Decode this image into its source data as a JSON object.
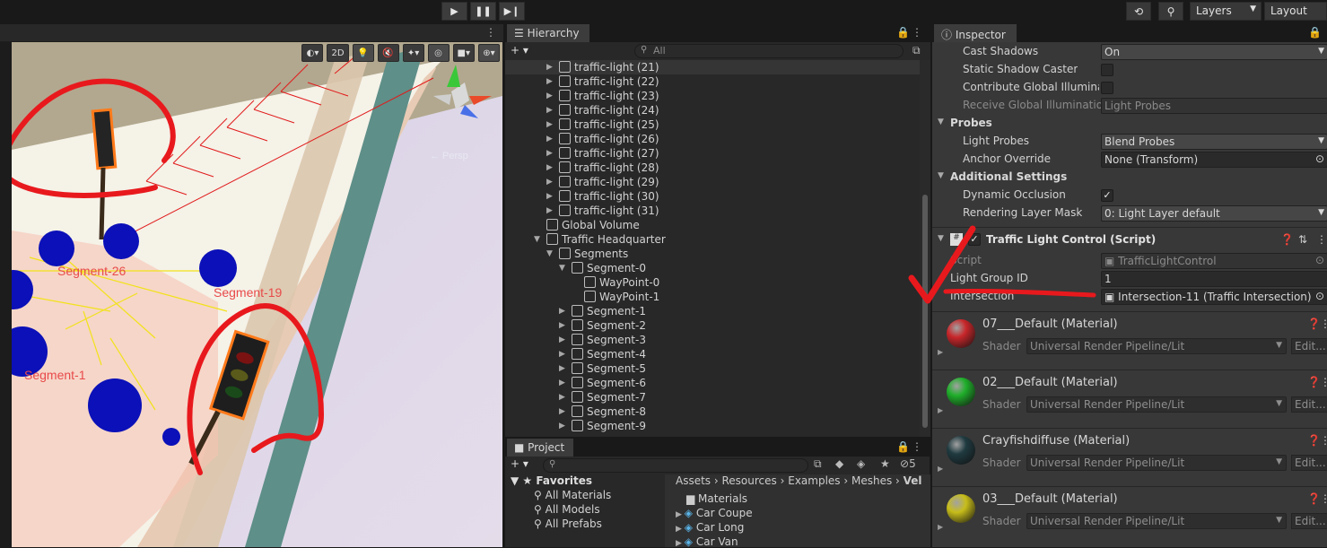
{
  "toolbar": {
    "play_icon": "play-icon",
    "pause_icon": "pause-icon",
    "step_icon": "step-icon",
    "history_icon": "history-icon",
    "search_icon": "search-icon",
    "layers_label": "Layers",
    "layout_label": "Layout"
  },
  "scene": {
    "mode_2d": "2D",
    "persp_label": "← Persp",
    "segment_labels": [
      "Segment-26",
      "Segment-19",
      "Segment-1"
    ]
  },
  "hierarchy": {
    "tab_label": "Hierarchy",
    "add_label": "+ ▾",
    "search_placeholder": "All",
    "rows": [
      {
        "label": "traffic-light (21)",
        "depth": 2,
        "arrow": "▶"
      },
      {
        "label": "traffic-light (22)",
        "depth": 2,
        "arrow": "▶"
      },
      {
        "label": "traffic-light (23)",
        "depth": 2,
        "arrow": "▶"
      },
      {
        "label": "traffic-light (24)",
        "depth": 2,
        "arrow": "▶"
      },
      {
        "label": "traffic-light (25)",
        "depth": 2,
        "arrow": "▶"
      },
      {
        "label": "traffic-light (26)",
        "depth": 2,
        "arrow": "▶"
      },
      {
        "label": "traffic-light (27)",
        "depth": 2,
        "arrow": "▶"
      },
      {
        "label": "traffic-light (28)",
        "depth": 2,
        "arrow": "▶"
      },
      {
        "label": "traffic-light (29)",
        "depth": 2,
        "arrow": "▶"
      },
      {
        "label": "traffic-light (30)",
        "depth": 2,
        "arrow": "▶"
      },
      {
        "label": "traffic-light (31)",
        "depth": 2,
        "arrow": "▶"
      },
      {
        "label": "Global Volume",
        "depth": 1,
        "arrow": ""
      },
      {
        "label": "Traffic Headquarter",
        "depth": 1,
        "arrow": "▼"
      },
      {
        "label": "Segments",
        "depth": 2,
        "arrow": "▼"
      },
      {
        "label": "Segment-0",
        "depth": 3,
        "arrow": "▼"
      },
      {
        "label": "WayPoint-0",
        "depth": 4,
        "arrow": ""
      },
      {
        "label": "WayPoint-1",
        "depth": 4,
        "arrow": ""
      },
      {
        "label": "Segment-1",
        "depth": 3,
        "arrow": "▶"
      },
      {
        "label": "Segment-2",
        "depth": 3,
        "arrow": "▶"
      },
      {
        "label": "Segment-3",
        "depth": 3,
        "arrow": "▶"
      },
      {
        "label": "Segment-4",
        "depth": 3,
        "arrow": "▶"
      },
      {
        "label": "Segment-5",
        "depth": 3,
        "arrow": "▶"
      },
      {
        "label": "Segment-6",
        "depth": 3,
        "arrow": "▶"
      },
      {
        "label": "Segment-7",
        "depth": 3,
        "arrow": "▶"
      },
      {
        "label": "Segment-8",
        "depth": 3,
        "arrow": "▶"
      },
      {
        "label": "Segment-9",
        "depth": 3,
        "arrow": "▶"
      }
    ]
  },
  "project": {
    "tab_label": "Project",
    "add_label": "+ ▾",
    "hidden_count": "5",
    "favorites_label": "Favorites",
    "favorites": [
      "All Materials",
      "All Models",
      "All Prefabs"
    ],
    "breadcrumb": [
      "Assets",
      "Resources",
      "Examples",
      "Meshes",
      "Vel"
    ],
    "items": [
      "Materials",
      "Car Coupe",
      "Car Long",
      "Car Van"
    ]
  },
  "inspector": {
    "tab_label": "Inspector",
    "cast_shadows_label": "Cast Shadows",
    "cast_shadows_value": "On",
    "static_shadow_caster_label": "Static Shadow Caster",
    "contribute_gi_label": "Contribute Global Illuminati",
    "receive_gi_label": "Receive Global Illumination",
    "receive_gi_value": "Light Probes",
    "probes_label": "Probes",
    "light_probes_label": "Light Probes",
    "light_probes_value": "Blend Probes",
    "anchor_override_label": "Anchor Override",
    "anchor_override_value": "None (Transform)",
    "additional_settings_label": "Additional Settings",
    "dynamic_occlusion_label": "Dynamic Occlusion",
    "rendering_layer_mask_label": "Rendering Layer Mask",
    "rendering_layer_mask_value": "0: Light Layer default",
    "component_title": "Traffic Light Control (Script)",
    "script_label": "Script",
    "script_value": "TrafficLightControl",
    "light_group_id_label": "Light Group ID",
    "light_group_id_value": "1",
    "intersection_label": "Intersection",
    "intersection_value": "Intersection-11 (Traffic Intersection)",
    "shader_label": "Shader",
    "edit_label": "Edit...",
    "materials": [
      {
        "name": "07___Default (Material)",
        "shader": "Universal Render Pipeline/Lit",
        "color": "#c8262a"
      },
      {
        "name": "02___Default (Material)",
        "shader": "Universal Render Pipeline/Lit",
        "color": "#1fae2a"
      },
      {
        "name": "Crayfishdiffuse (Material)",
        "shader": "Universal Render Pipeline/Lit",
        "color": "#1f3a40"
      },
      {
        "name": "03___Default (Material)",
        "shader": "Universal Render Pipeline/Lit",
        "color": "#c7bd1a"
      }
    ]
  }
}
